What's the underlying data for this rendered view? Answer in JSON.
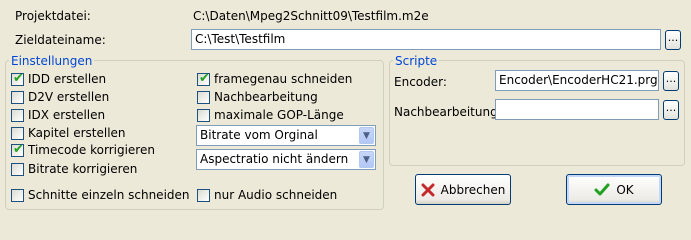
{
  "project": {
    "label": "Projektdatei:",
    "value": "C:\\Daten\\Mpeg2Schnitt09\\Testfilm.m2e"
  },
  "target": {
    "label": "Zieldateiname:",
    "value": "C:\\Test\\Testfilm",
    "browse": "..."
  },
  "settings": {
    "legend": "Einstellungen",
    "left": [
      {
        "label": "IDD erstellen",
        "checked": true
      },
      {
        "label": "D2V erstellen",
        "checked": false
      },
      {
        "label": "IDX erstellen",
        "checked": false
      },
      {
        "label": "Kapitel erstellen",
        "checked": false
      },
      {
        "label": "Timecode korrigieren",
        "checked": true
      },
      {
        "label": "Bitrate korrigieren",
        "checked": false
      }
    ],
    "right": [
      {
        "label": "framegenau schneiden",
        "checked": true
      },
      {
        "label": "Nachbearbeitung",
        "checked": false
      },
      {
        "label": "maximale GOP-Länge",
        "checked": false
      }
    ],
    "bitrate_select": "Bitrate vom Orginal",
    "aspect_select": "Aspectratio nicht ändern",
    "cut_single": {
      "label": "Schnitte einzeln schneiden",
      "checked": false
    },
    "audio_only": {
      "label": "nur Audio schneiden",
      "checked": false
    }
  },
  "scripts": {
    "legend": "Scripte",
    "encoder_label": "Encoder:",
    "encoder_value": "Encoder\\EncoderHC21.prg",
    "post_label": "Nachbearbeitung:",
    "post_value": "",
    "browse": "..."
  },
  "buttons": {
    "cancel": "Abbrechen",
    "ok": "OK"
  },
  "colors": {
    "background": "#ece9d8",
    "legend": "#0046d5",
    "check": "#21a121",
    "cancel_icon": "#c4292b"
  }
}
